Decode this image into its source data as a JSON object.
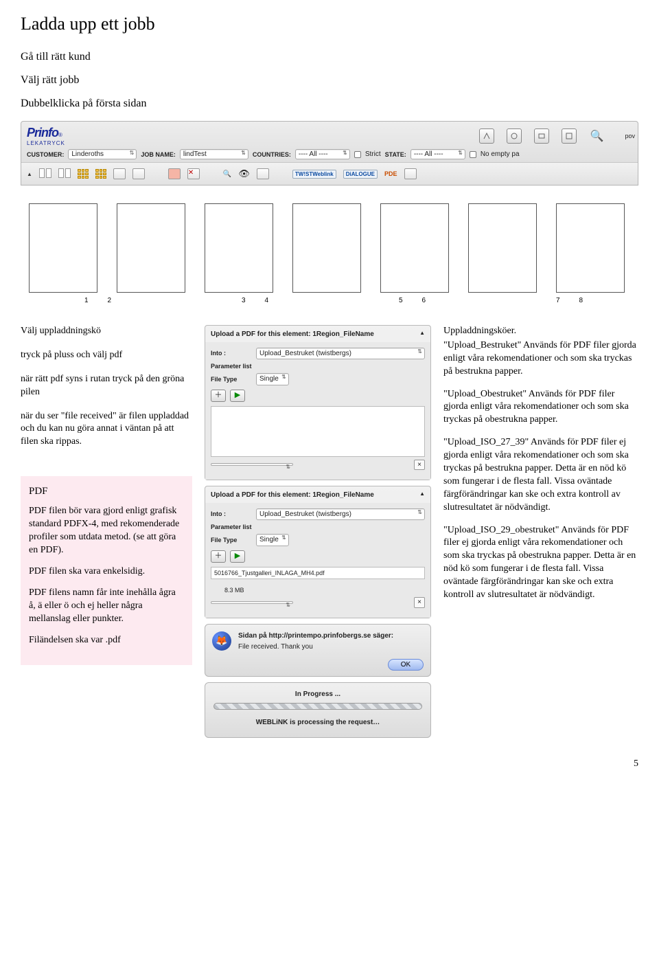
{
  "page_number": "5",
  "heading": "Ladda upp ett jobb",
  "intro": {
    "line1": "Gå till rätt kund",
    "line2": "Välj rätt jobb",
    "line3": "Dubbelklicka på första sidan"
  },
  "app": {
    "brand_name": "Prinfo",
    "brand_sub": "LEKATRYCK",
    "pow": "pov",
    "customer_label": "CUSTOMER:",
    "customer_value": "Linderoths",
    "jobname_label": "JOB NAME:",
    "jobname_value": "lindTest",
    "countries_label": "COUNTRIES:",
    "countries_value": "---- All ----",
    "strict_label": "Strict",
    "state_label": "STATE:",
    "state_value": "---- All ----",
    "noempty_label": "No empty pa",
    "tw_weblink": "TW!STWeblink",
    "dialogue": "DiALOGUE",
    "pde": "PDE"
  },
  "pages": {
    "labels": [
      "1",
      "2",
      "3",
      "4",
      "5",
      "6",
      "7",
      "8"
    ]
  },
  "left": {
    "p1": "Välj uppladdningskö",
    "p2": "tryck på pluss och välj pdf",
    "p3": "när rätt pdf syns i rutan tryck på den gröna pilen",
    "p4": "när du ser \"file received\" är filen uppladdad och du kan nu göra annat i väntan på att filen ska rippas.",
    "box_title": "PDF",
    "box_p1": "PDF filen bör vara gjord enligt grafisk standard PDFX-4, med rekomenderade profiler som utdata metod. (se att göra en PDF).",
    "box_p2": "PDF filen ska vara enkelsidig.",
    "box_p3": "PDF filens namn får inte inehålla ågra å, ä eller ö och ej heller några mellanslag eller punkter.",
    "box_p4": "Filändelsen ska var .pdf"
  },
  "mid": {
    "panel_title": "Upload a PDF for this element: 1Region_FileName",
    "into_label": "Into :",
    "into_value": "Upload_Bestruket (twistbergs)",
    "param_list": "Parameter list",
    "file_type_label": "File Type",
    "file_type_value": "Single",
    "file_name": "5016766_Tjustgalleri_INLAGA_MH4.pdf",
    "file_size": "8.3 MB",
    "into_value2": "Upload_Bestruket (twistbergs)",
    "dialog_line1": "Sidan på http://printempo.prinfobergs.se säger:",
    "dialog_line2": "File received. Thank you",
    "ok": "OK",
    "progress_top": "In Progress ...",
    "progress_sub": "WEBLiNK is processing the request…"
  },
  "right": {
    "h": "Uppladdningsköer.",
    "p1": "\"Upload_Bestruket\" Används för PDF filer gjorda enligt våra rekomendationer och som ska tryckas på bestrukna papper.",
    "p2": "\"Upload_Obestruket\" Används för PDF filer gjorda enligt våra rekomendationer och som ska tryckas på obestrukna papper.",
    "p3": "\"Upload_ISO_27_39\" Används för PDF filer ej gjorda enligt våra rekomendationer och som ska tryckas på bestrukna papper. Detta är en nöd kö som fungerar i de flesta fall. Vissa oväntade färgförändringar kan ske och extra kontroll av slutresultatet är nödvändigt.",
    "p4": "\"Upload_ISO_29_obestruket\" Används för PDF filer ej gjorda enligt våra rekomendationer och som ska tryckas på obestrukna papper. Detta är en nöd kö som fungerar i de flesta fall. Vissa oväntade färgförändringar kan ske och extra kontroll av slutresultatet är nödvändigt."
  }
}
